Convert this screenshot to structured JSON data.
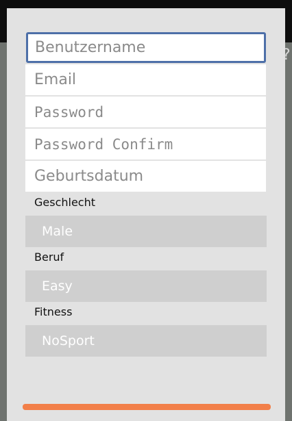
{
  "form": {
    "username_placeholder": "Benutzername",
    "email_placeholder": "Email",
    "password_placeholder": "Password",
    "password_confirm_placeholder": "Password Confirm",
    "birthdate_placeholder": "Geburtsdatum"
  },
  "gender": {
    "label": "Geschlecht",
    "value": "Male"
  },
  "job": {
    "label": "Beruf",
    "value": "Easy"
  },
  "fitness": {
    "label": "Fitness",
    "value": "NoSport"
  },
  "colors": {
    "accent_bar": "#f27f49",
    "focus_border": "#4d6fa8"
  }
}
